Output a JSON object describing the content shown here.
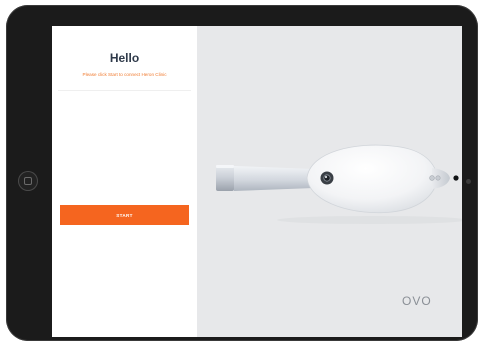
{
  "login": {
    "title": "Hello",
    "subtitle": "Please click Start to connect Heron Clinic",
    "start_label": "START"
  },
  "brand": {
    "logo_text": "OVO"
  },
  "colors": {
    "accent": "#F5651F",
    "subtitle": "#F07A2F",
    "title": "#2F3A4A",
    "right_panel_bg": "#E7E8EA"
  },
  "icons": {
    "home": "home-button-icon",
    "camera": "front-camera-icon",
    "device": "intraoral-scanner-device-image"
  }
}
